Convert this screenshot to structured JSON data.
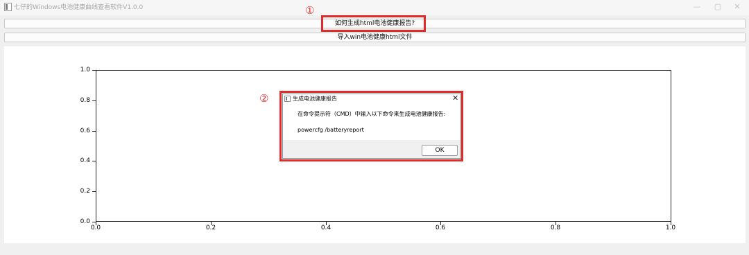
{
  "window": {
    "title": "七仔的Windows电池健康曲线查看软件V1.0.0",
    "minimize_glyph": "—",
    "maximize_glyph": "▢",
    "close_glyph": "✕",
    "icon": "app-icon"
  },
  "buttons": {
    "how_to_generate": "如何生成html电池健康报告?",
    "import_html": "导入win电池健康html文件"
  },
  "annotations": {
    "label1": "①",
    "label2": "②",
    "color": "#e02b2b"
  },
  "chart_data": {
    "type": "line",
    "series": [],
    "xlim": [
      0.0,
      1.0
    ],
    "ylim": [
      0.0,
      1.0
    ],
    "x_ticks": [
      "0.0",
      "0.2",
      "0.4",
      "0.6",
      "0.8",
      "1.0"
    ],
    "y_ticks": [
      "0.0",
      "0.2",
      "0.4",
      "0.6",
      "0.8",
      "1.0"
    ],
    "title": "",
    "xlabel": "",
    "ylabel": ""
  },
  "dialog": {
    "title": "生成电池健康报告",
    "close_glyph": "✕",
    "message": "在命令提示符（CMD）中输入以下命令来生成电池健康报告:",
    "command": "powercfg /batteryreport",
    "ok_label": "OK",
    "icon": "app-icon"
  }
}
